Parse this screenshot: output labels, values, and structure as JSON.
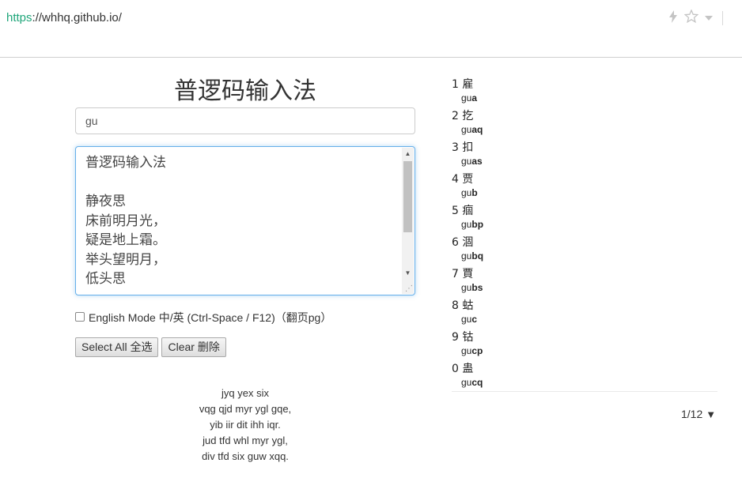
{
  "browser": {
    "url_scheme": "https",
    "url_rest": "://whhq.github.io/"
  },
  "app": {
    "title": "普逻码输入法",
    "code_input_value": "gu",
    "text_lines": [
      "普逻码输入法",
      "",
      "静夜思",
      "床前明月光，",
      "疑是地上霜。",
      "举头望明月，",
      "低头思"
    ],
    "english_mode_label": "English Mode 中/英 (Ctrl-Space / F12)（翻页pg）",
    "english_mode_checked": false,
    "select_all_label": "Select All 全选",
    "clear_label": "Clear 删除",
    "code_lines": [
      "jyq yex six",
      "vqg qjd myr ygl gqe,",
      "yib iir dit ihh iqr.",
      "jud tfd whl myr ygl,",
      "div tfd six guw xqq."
    ]
  },
  "candidates": [
    {
      "num": "1",
      "char": "雇",
      "code_prefix": "gu",
      "code_suffix": "a"
    },
    {
      "num": "2",
      "char": "扢",
      "code_prefix": "gu",
      "code_suffix": "aq"
    },
    {
      "num": "3",
      "char": "扣",
      "code_prefix": "gu",
      "code_suffix": "as"
    },
    {
      "num": "4",
      "char": "贾",
      "code_prefix": "gu",
      "code_suffix": "b"
    },
    {
      "num": "5",
      "char": "痼",
      "code_prefix": "gu",
      "code_suffix": "bp"
    },
    {
      "num": "6",
      "char": "涸",
      "code_prefix": "gu",
      "code_suffix": "bq"
    },
    {
      "num": "7",
      "char": "賈",
      "code_prefix": "gu",
      "code_suffix": "bs"
    },
    {
      "num": "8",
      "char": "蛄",
      "code_prefix": "gu",
      "code_suffix": "c"
    },
    {
      "num": "9",
      "char": "钴",
      "code_prefix": "gu",
      "code_suffix": "cp"
    },
    {
      "num": "0",
      "char": "蛊",
      "code_prefix": "gu",
      "code_suffix": "cq"
    }
  ],
  "pager": {
    "label": "1/12",
    "arrow": "▼"
  },
  "icons": {
    "lightning": "lightning-icon",
    "star": "star-icon",
    "dropdown": "chevron-down-icon"
  }
}
